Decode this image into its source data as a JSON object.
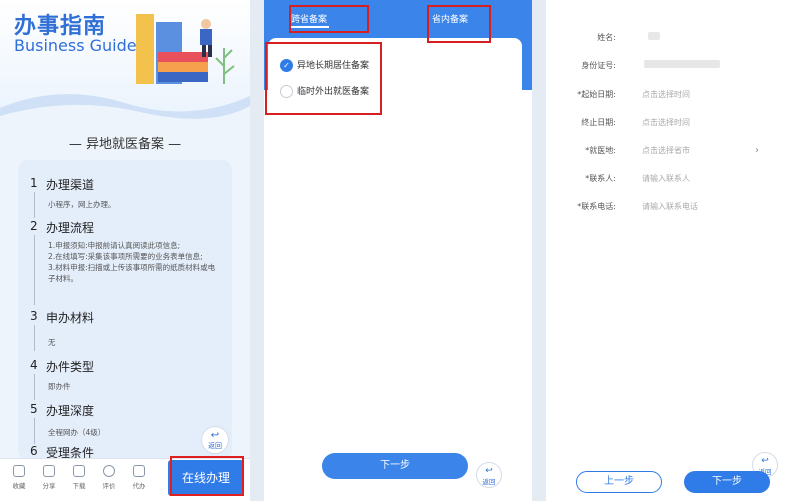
{
  "guide": {
    "title": "办事指南",
    "subtitle": "Business Guide",
    "heading": "—  异地就医备案  —",
    "steps": [
      {
        "num": "1",
        "title": "办理渠道",
        "content": "小程序，网上办理。"
      },
      {
        "num": "2",
        "title": "办理流程",
        "content": "1.申报须知:申报前请认真阅读此项信息;\n2.在线填写:采集该事项所需要的业务表单信息;\n3.材料申报:扫描或上传该事项所需的纸质材料或电子材料。"
      },
      {
        "num": "3",
        "title": "申办材料",
        "content": "无"
      },
      {
        "num": "4",
        "title": "办件类型",
        "content": "即办件"
      },
      {
        "num": "5",
        "title": "办理深度",
        "content": "全程网办（4级）"
      },
      {
        "num": "6",
        "title": "受理条件",
        "content": ""
      }
    ],
    "back_label": "返回",
    "bottom_bar": [
      {
        "label": "收藏",
        "icon": "star-icon"
      },
      {
        "label": "分享",
        "icon": "share-icon"
      },
      {
        "label": "下载",
        "icon": "download-icon"
      },
      {
        "label": "评价",
        "icon": "comment-icon"
      },
      {
        "label": "代办",
        "icon": "delegate-icon"
      }
    ],
    "online_button": "在线办理"
  },
  "filing": {
    "tabs": [
      {
        "label": "跨省备案",
        "active": true
      },
      {
        "label": "省内备案",
        "active": false
      }
    ],
    "options": [
      {
        "label": "异地长期居住备案",
        "selected": true
      },
      {
        "label": "临时外出就医备案",
        "selected": false
      }
    ],
    "next_button": "下一步",
    "back_label": "返回"
  },
  "form": {
    "fields": [
      {
        "label": "姓名:",
        "value": "",
        "required": false
      },
      {
        "label": "身份证号:",
        "value": "",
        "required": false
      },
      {
        "label": "*起始日期:",
        "value": "点击选择时间",
        "required": true
      },
      {
        "label": "终止日期:",
        "value": "点击选择时间",
        "required": false
      },
      {
        "label": "*就医地:",
        "value": "点击选择省市",
        "required": true
      },
      {
        "label": "*联系人:",
        "value": "请输入联系人",
        "required": true
      },
      {
        "label": "*联系电话:",
        "value": "请输入联系电话",
        "required": true
      }
    ],
    "prev_button": "上一步",
    "next_button": "下一步",
    "back_label": "返回"
  },
  "colors": {
    "primary": "#2f7be8",
    "header_blue": "#3b85ea",
    "highlight_red": "#d42020"
  }
}
